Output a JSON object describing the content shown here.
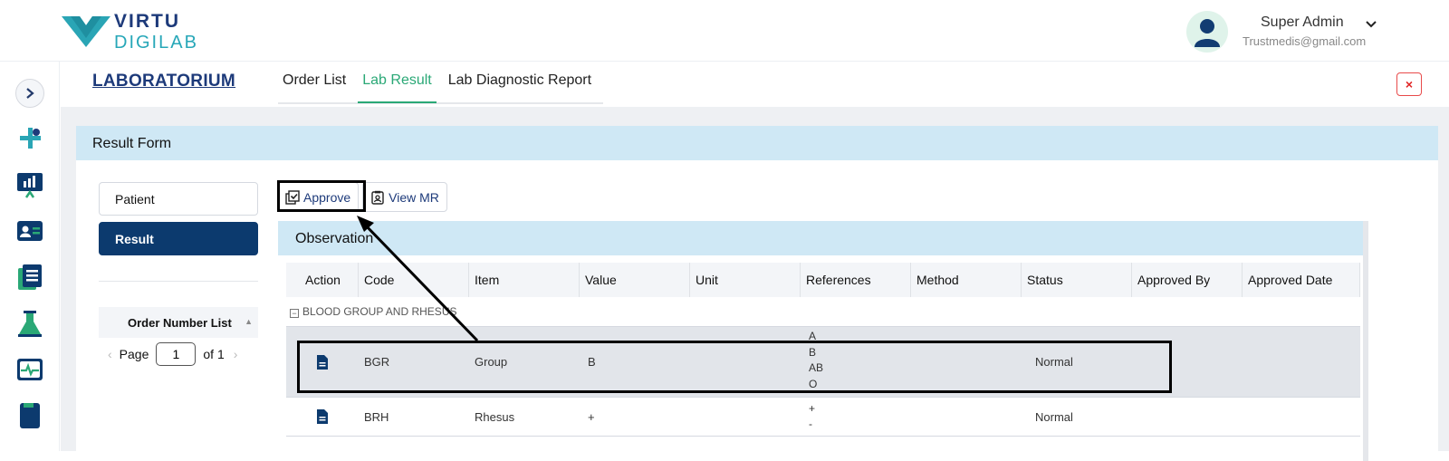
{
  "brand": {
    "line1": "VIRTU",
    "line2": "DIGILAB"
  },
  "user": {
    "name": "Super Admin",
    "email": "Trustmedis@gmail.com"
  },
  "sidebar": {
    "icons": [
      "expand-icon",
      "health-logo-icon",
      "monitor-chart-icon",
      "id-card-icon",
      "document-list-icon",
      "flask-icon",
      "heart-monitor-icon",
      "book-icon"
    ]
  },
  "page": {
    "title": "LABORATORIUM",
    "tabs": [
      {
        "label": "Order List"
      },
      {
        "label": "Lab Result"
      },
      {
        "label": "Lab Diagnostic Report"
      }
    ],
    "close_label": "×"
  },
  "form": {
    "title": "Result Form",
    "nav": [
      {
        "label": "Patient"
      },
      {
        "label": "Result"
      }
    ],
    "order_list_title": "Order Number List",
    "pager": {
      "page_label": "Page",
      "page_value": "1",
      "of_label": "of 1"
    },
    "actions": {
      "approve": "Approve",
      "view_mr": "View MR"
    }
  },
  "observation": {
    "title": "Observation",
    "columns": [
      "Action",
      "Code",
      "Item",
      "Value",
      "Unit",
      "References",
      "Method",
      "Status",
      "Approved By",
      "Approved Date"
    ],
    "group": "BLOOD GROUP AND RHESUS",
    "rows": [
      {
        "code": "BGR",
        "item": "Group",
        "value": "B",
        "unit": "",
        "references": [
          "A",
          "B",
          "AB",
          "O"
        ],
        "method": "",
        "status": "Normal",
        "approved_by": "",
        "approved_date": ""
      },
      {
        "code": "BRH",
        "item": "Rhesus",
        "value": "+",
        "unit": "",
        "references": [
          "+",
          "-"
        ],
        "method": "",
        "status": "Normal",
        "approved_by": "",
        "approved_date": ""
      }
    ]
  },
  "colors": {
    "brand_navy": "#0c3a6e",
    "accent_green": "#2aa876",
    "header_blue": "#cfe8f5",
    "danger": "#e02424"
  }
}
